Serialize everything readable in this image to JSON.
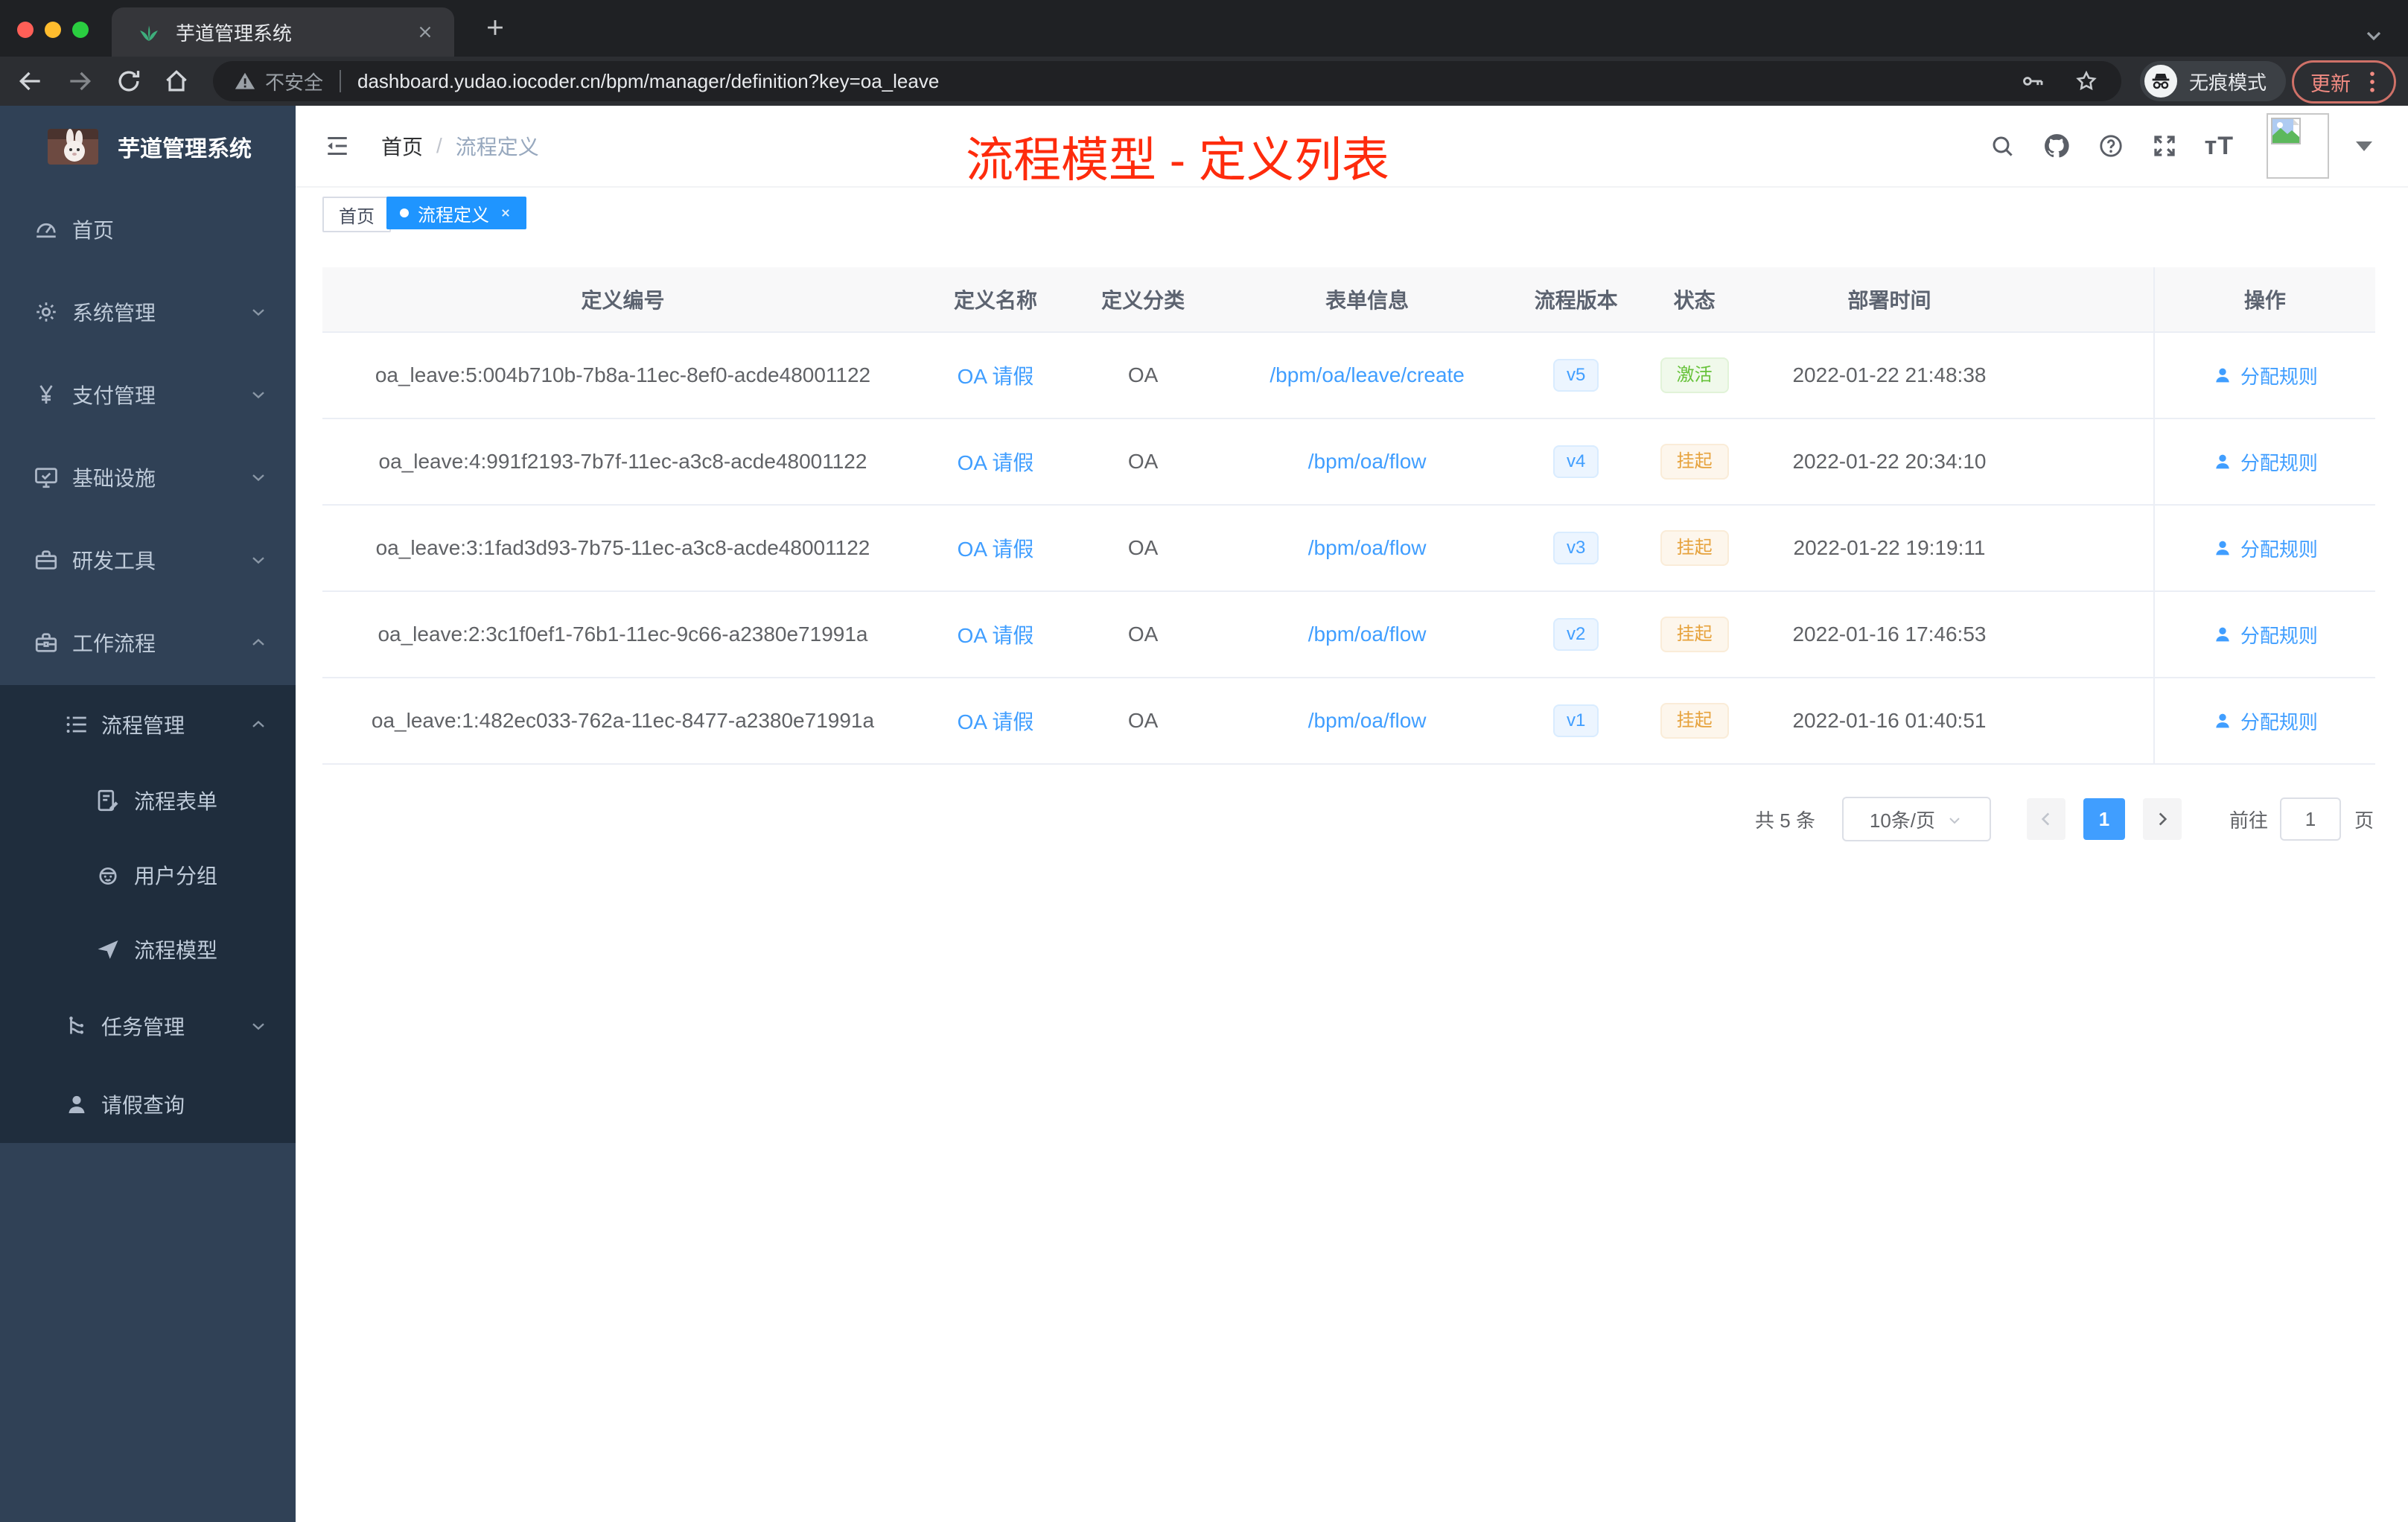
{
  "browser": {
    "tab_title": "芋道管理系统",
    "security_label": "不安全",
    "url_domain": "dashboard.yudao.iocoder.cn",
    "url_path": "/bpm/manager/definition?key=oa_leave",
    "incognito_label": "无痕模式",
    "update_label": "更新"
  },
  "sidebar": {
    "app_title": "芋道管理系统",
    "items": [
      {
        "label": "首页",
        "icon": "dashboard-icon",
        "expandable": false
      },
      {
        "label": "系统管理",
        "icon": "gear-icon",
        "expandable": true,
        "expanded": false
      },
      {
        "label": "支付管理",
        "icon": "yen-icon",
        "expandable": true,
        "expanded": false
      },
      {
        "label": "基础设施",
        "icon": "monitor-icon",
        "expandable": true,
        "expanded": false
      },
      {
        "label": "研发工具",
        "icon": "toolbox-icon",
        "expandable": true,
        "expanded": false
      },
      {
        "label": "工作流程",
        "icon": "briefcase-icon",
        "expandable": true,
        "expanded": true
      }
    ],
    "submenu": [
      {
        "label": "流程管理",
        "icon": "stream-icon",
        "level": 1,
        "expandable": true,
        "expanded": true
      },
      {
        "label": "流程表单",
        "icon": "form-edit-icon",
        "level": 2
      },
      {
        "label": "用户分组",
        "icon": "robot-icon",
        "level": 2
      },
      {
        "label": "流程模型",
        "icon": "paper-plane-icon",
        "level": 2
      },
      {
        "label": "任务管理",
        "icon": "tree-icon",
        "level": 1,
        "expandable": true,
        "expanded": false
      },
      {
        "label": "请假查询",
        "icon": "user-icon",
        "level": 1
      }
    ]
  },
  "header": {
    "breadcrumb_home": "首页",
    "breadcrumb_separator": "/",
    "breadcrumb_current": "流程定义"
  },
  "annotation": "流程模型 - 定义列表",
  "tags": [
    {
      "label": "首页",
      "active": false
    },
    {
      "label": "流程定义",
      "active": true,
      "closable": true
    }
  ],
  "table": {
    "columns": [
      "定义编号",
      "定义名称",
      "定义分类",
      "表单信息",
      "流程版本",
      "状态",
      "部署时间",
      "操作"
    ],
    "action_label": "分配规则",
    "rows": [
      {
        "id": "oa_leave:5:004b710b-7b8a-11ec-8ef0-acde48001122",
        "name": "OA 请假",
        "category": "OA",
        "form": "/bpm/oa/leave/create",
        "version": "v5",
        "status": "激活",
        "status_type": "success",
        "deploy_time": "2022-01-22 21:48:38"
      },
      {
        "id": "oa_leave:4:991f2193-7b7f-11ec-a3c8-acde48001122",
        "name": "OA 请假",
        "category": "OA",
        "form": "/bpm/oa/flow",
        "version": "v4",
        "status": "挂起",
        "status_type": "warning",
        "deploy_time": "2022-01-22 20:34:10"
      },
      {
        "id": "oa_leave:3:1fad3d93-7b75-11ec-a3c8-acde48001122",
        "name": "OA 请假",
        "category": "OA",
        "form": "/bpm/oa/flow",
        "version": "v3",
        "status": "挂起",
        "status_type": "warning",
        "deploy_time": "2022-01-22 19:19:11"
      },
      {
        "id": "oa_leave:2:3c1f0ef1-76b1-11ec-9c66-a2380e71991a",
        "name": "OA 请假",
        "category": "OA",
        "form": "/bpm/oa/flow",
        "version": "v2",
        "status": "挂起",
        "status_type": "warning",
        "deploy_time": "2022-01-16 17:46:53"
      },
      {
        "id": "oa_leave:1:482ec033-762a-11ec-8477-a2380e71991a",
        "name": "OA 请假",
        "category": "OA",
        "form": "/bpm/oa/flow",
        "version": "v1",
        "status": "挂起",
        "status_type": "warning",
        "deploy_time": "2022-01-16 01:40:51"
      }
    ]
  },
  "pagination": {
    "total_label": "共 5 条",
    "page_size": "10条/页",
    "current_page": "1",
    "goto_label": "前往",
    "goto_value": "1",
    "page_suffix": "页"
  },
  "colors": {
    "accent_blue": "#409eff",
    "annotation_red": "#fe2b0c",
    "status_active_green": "#67c23a",
    "status_suspended_orange": "#e6a23c",
    "sidebar_bg": "#304156",
    "submenu_bg": "#1f2d3d"
  }
}
